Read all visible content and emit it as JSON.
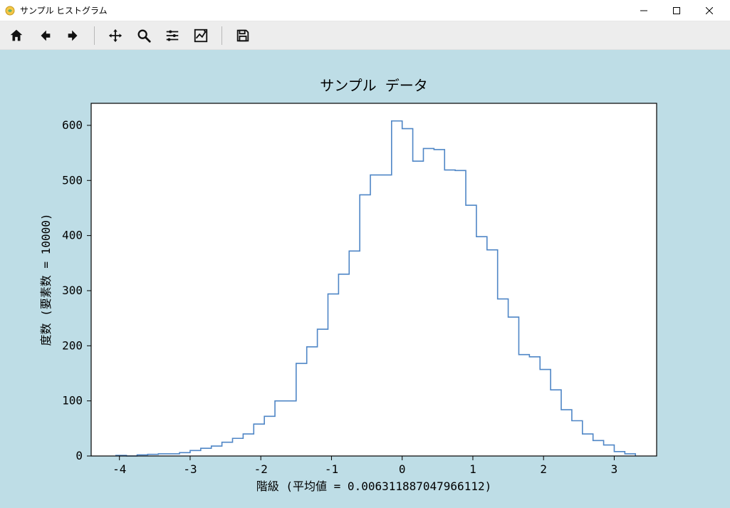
{
  "window": {
    "title": "サンプル ヒストグラム"
  },
  "toolbar": {
    "home": "home",
    "back": "back",
    "forward": "forward",
    "pan": "pan",
    "zoom": "zoom",
    "subplots": "configure-subplots",
    "axes": "edit-axes",
    "save": "save"
  },
  "chart_data": {
    "type": "histogram_step",
    "title": "サンプル データ",
    "xlabel": "階級 (平均値 = 0.006311887047966112)",
    "ylabel": "度数 (要素数 = 10000)",
    "xlim": [
      -4.4,
      3.6
    ],
    "ylim": [
      0,
      640
    ],
    "xticks": [
      -4,
      -3,
      -2,
      -1,
      0,
      1,
      2,
      3
    ],
    "yticks": [
      0,
      100,
      200,
      300,
      400,
      500,
      600
    ],
    "bin_width": 0.15,
    "bin_left_edges": [
      -4.05,
      -3.9,
      -3.75,
      -3.6,
      -3.45,
      -3.3,
      -3.15,
      -3.0,
      -2.85,
      -2.7,
      -2.55,
      -2.4,
      -2.25,
      -2.1,
      -1.95,
      -1.8,
      -1.65,
      -1.5,
      -1.35,
      -1.2,
      -1.05,
      -0.9,
      -0.75,
      -0.6,
      -0.45,
      -0.3,
      -0.15,
      0.0,
      0.15,
      0.3,
      0.45,
      0.6,
      0.75,
      0.9,
      1.05,
      1.2,
      1.35,
      1.5,
      1.65,
      1.8,
      1.95,
      2.1,
      2.25,
      2.4,
      2.55,
      2.7,
      2.85,
      3.0,
      3.15
    ],
    "counts": [
      1,
      0,
      2,
      3,
      4,
      4,
      6,
      10,
      14,
      18,
      25,
      32,
      40,
      58,
      72,
      100,
      100,
      168,
      198,
      230,
      294,
      330,
      372,
      474,
      510,
      510,
      608,
      594,
      535,
      558,
      556,
      519,
      518,
      455,
      398,
      374,
      285,
      252,
      184,
      180,
      157,
      120,
      84,
      64,
      40,
      28,
      20,
      8,
      4
    ],
    "line_color": "#4f86c6"
  }
}
